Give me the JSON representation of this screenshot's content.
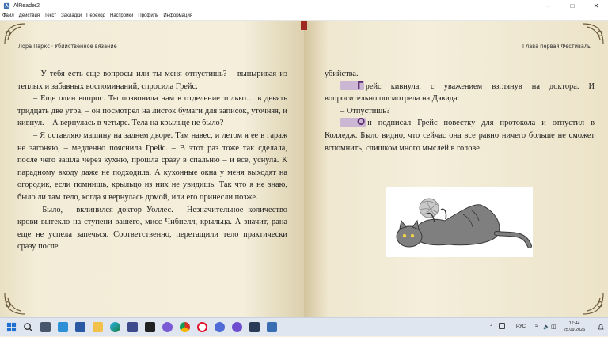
{
  "window": {
    "title": "AlReader2",
    "controls": [
      "minimize-icon",
      "maximize-icon",
      "close-icon"
    ]
  },
  "menu": {
    "items": [
      "Файл",
      "Действия",
      "Текст",
      "Закладки",
      "Переход",
      "Настройки",
      "Профиль",
      "Информация"
    ]
  },
  "left_page": {
    "header": "Лора Паркс · Убийственное вязание",
    "paragraphs": [
      "– У тебя есть еще вопросы или ты меня отпустишь? – выныривая из теплых и забавных воспоминаний, спросила Грейс.",
      "– Еще один вопрос. Ты позвонила нам в отделение только… в девять тридцать две утра, – он посмотрел на листок бумаги для записок, уточняя, и кивнул. – А вернулась в четыре. Тела на крыльце не было?",
      "– Я оставляю машину на заднем дворе. Там навес, и летом я ее в гараж не загоняю, – медленно пояснила Грейс. – В этот раз тоже так сделала, после чего зашла через кухню, прошла сразу в спальню – и все, уснула. К парадному входу даже не подходила. А кухонные окна у меня выходят на огородик, если помнишь, крыльцо из них не увидишь. Так что я не знаю, было ли там тело, когда я вернулась домой, или его принесли позже.",
      "– Было, – вклинился доктор Уоллес. – Незначительное количество крови вытекло на ступени вашего, мисс Чибнелл, крыльца. А значит, рана еще не успела запечься. Соответственно, перетащили тело практически сразу после"
    ]
  },
  "right_page": {
    "header": "Глава первая Фестиваль",
    "paragraphs": [
      {
        "dropcap": "",
        "text": "убийства."
      },
      {
        "dropcap": "Г",
        "text": "рейс кивнула, с уважением взглянув на доктора. И вопросительно посмотрела на Дэвида:"
      },
      {
        "dropcap": "",
        "text": "– Отпустишь?"
      },
      {
        "dropcap": "О",
        "text": "н подписал Грейс повестку для протокола и отпустил в Колледж. Было видно, что сейчас она все равно ничего больше не сможет вспомнить, слишком много мыслей в голове."
      }
    ],
    "illustration": "cat-with-yarn-ball"
  },
  "taskbar": {
    "apps": [
      "windows-start-icon",
      "search-icon",
      "task-view-icon",
      "widgets-icon",
      "explorer-icon",
      "edge-icon",
      "store-icon",
      "app-icon-1",
      "app-icon-2",
      "chrome-icon",
      "opera-icon",
      "app-icon-3",
      "app-icon-4",
      "app-icon-5",
      "alreader-icon"
    ],
    "tray": {
      "language": "РУС",
      "time": "12:44",
      "date": "25.09.2026"
    }
  },
  "colors": {
    "page": "#f4eedb",
    "accent_dropcap": "#5a2a6e",
    "dropcap_bg": "#cbb6d3",
    "bookmark": "#9c2a22"
  }
}
